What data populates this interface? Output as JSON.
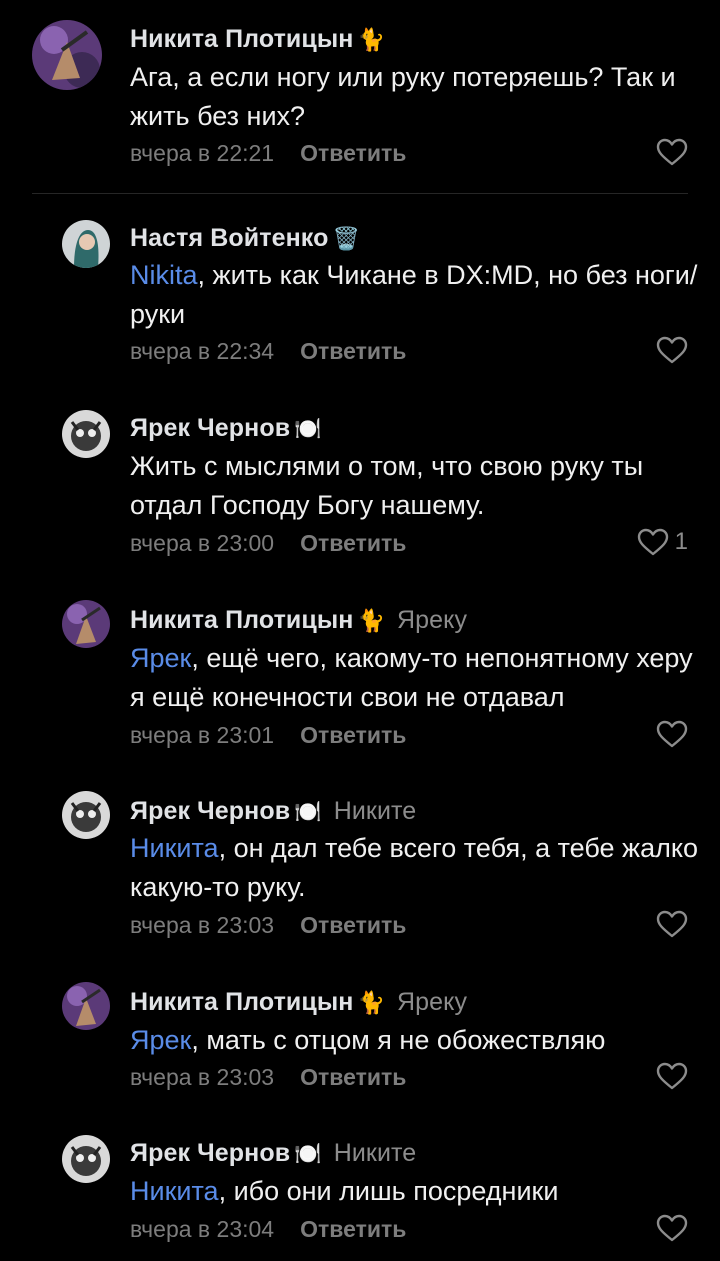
{
  "comments": [
    {
      "author": "Никита Плотицын",
      "emoji": "🐈",
      "reply_to": "",
      "mention": "",
      "text": "Ага, а если ногу или руку потеряешь? Так и жить без них?",
      "time": "вчера в 22:21",
      "reply_label": "Ответить",
      "likes": ""
    },
    {
      "author": "Настя Войтенко",
      "emoji": "🗑️",
      "reply_to": "",
      "mention": "Nikita",
      "text": ", жить как Чикане в DX:MD, но без ноги/руки",
      "time": "вчера в 22:34",
      "reply_label": "Ответить",
      "likes": ""
    },
    {
      "author": "Ярек Чернов",
      "emoji": "🍽️",
      "reply_to": "",
      "mention": "",
      "text": "Жить с мыслями о том, что свою руку ты отдал Господу Богу нашему.",
      "time": "вчера в 23:00",
      "reply_label": "Ответить",
      "likes": "1"
    },
    {
      "author": "Никита Плотицын",
      "emoji": "🐈",
      "reply_to": "Яреку",
      "mention": "Ярек",
      "text": ", ещё чего, какому-то непонятному херу я ещё конечности свои не отдавал",
      "time": "вчера в 23:01",
      "reply_label": "Ответить",
      "likes": ""
    },
    {
      "author": "Ярек Чернов",
      "emoji": "🍽️",
      "reply_to": "Никите",
      "mention": "Никита",
      "text": ", он дал тебе всего тебя, а тебе жалко какую-то руку.",
      "time": "вчера в 23:03",
      "reply_label": "Ответить",
      "likes": ""
    },
    {
      "author": "Никита Плотицын",
      "emoji": "🐈",
      "reply_to": "Яреку",
      "mention": "Ярек",
      "text": ", мать с отцом я не обожествляю",
      "time": "вчера в 23:03",
      "reply_label": "Ответить",
      "likes": ""
    },
    {
      "author": "Ярек Чернов",
      "emoji": "🍽️",
      "reply_to": "Никите",
      "mention": "Никита",
      "text": ", ибо они лишь посредники",
      "time": "вчера в 23:04",
      "reply_label": "Ответить",
      "likes": ""
    }
  ],
  "colors": {
    "background": "#000000",
    "mention": "#5a8ce8",
    "meta": "#7d7d7d"
  },
  "icons": {
    "like": "heart-outline-icon"
  }
}
